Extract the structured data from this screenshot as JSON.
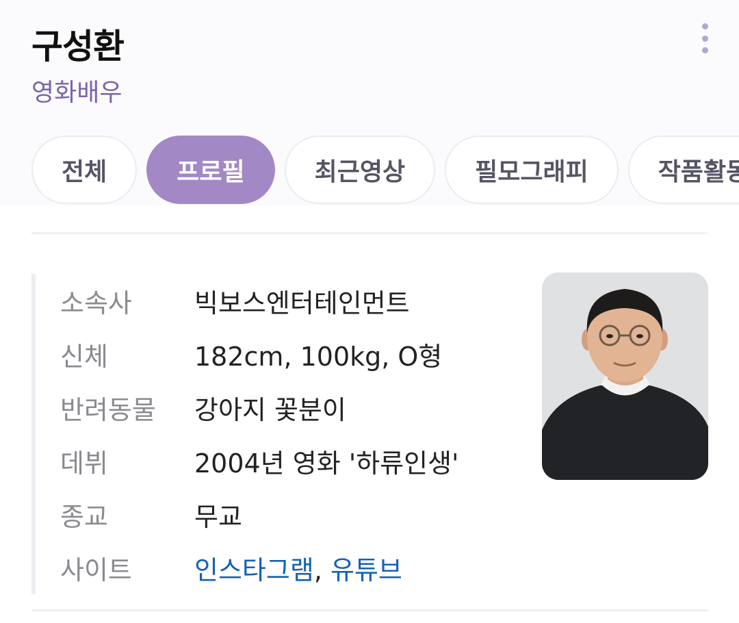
{
  "header": {
    "name": "구성환",
    "occupation": "영화배우"
  },
  "tabs": [
    {
      "label": "전체",
      "active": false
    },
    {
      "label": "프로필",
      "active": true
    },
    {
      "label": "최근영상",
      "active": false
    },
    {
      "label": "필모그래피",
      "active": false
    },
    {
      "label": "작품활동",
      "active": false
    }
  ],
  "profile": {
    "agency_label": "소속사",
    "agency_value": "빅보스엔터테인먼트",
    "body_label": "신체",
    "body_value": "182cm, 100kg, O형",
    "pet_label": "반려동물",
    "pet_value": "강아지 꽃분이",
    "debut_label": "데뷔",
    "debut_value": "2004년 영화 '하류인생'",
    "religion_label": "종교",
    "religion_value": "무교",
    "site_label": "사이트",
    "site_instagram": "인스타그램",
    "site_separator": ",",
    "site_youtube": "유튜브"
  },
  "colors": {
    "accent": "#a288c4",
    "link": "#1461b6",
    "subtitle": "#7a64a8"
  },
  "icons": {
    "more": "more-vertical-icon"
  }
}
